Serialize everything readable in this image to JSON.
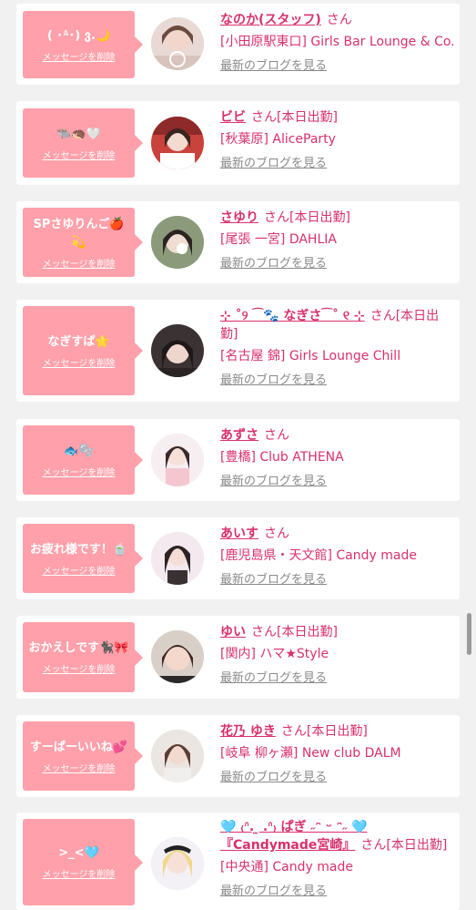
{
  "theme": {
    "accent": "#d8306c",
    "bubble": "#ffa0aa",
    "link_gray": "#8a8a8a"
  },
  "common": {
    "san": "さん",
    "delete_label": "メッセージを削除",
    "blog_label": "最新のブログを見る"
  },
  "items": [
    {
      "message": "( ･ᐞ･) ვ.🌙",
      "name": "なのか(スタッフ)",
      "status": "",
      "shop": "[小田原駅東口] Girls Bar Lounge & Co.",
      "avatar_icon": "avatar-photo"
    },
    {
      "message": "🐃🦔🤍",
      "name": "ビビ",
      "status": "[本日出勤]",
      "shop": "[秋葉原] AliceParty",
      "avatar_icon": "avatar-photo"
    },
    {
      "message": "SPさゆりんご🍎💫",
      "name": "さゆり",
      "status": "[本日出勤]",
      "shop": "[尾張 一宮] DAHLIA",
      "avatar_icon": "avatar-photo"
    },
    {
      "message": "なぎすぱ🌟",
      "name": "⊹ ˚୨ ⁀🐾 なぎさ⁀˚ ୧ ⊹",
      "status": "[本日出勤]",
      "shop": "[名古屋 錦] Girls Lounge Chill",
      "avatar_icon": "avatar-photo"
    },
    {
      "message": "🐟🫧",
      "name": "あずさ",
      "status": "",
      "shop": "[豊橋] Club ATHENA",
      "avatar_icon": "avatar-photo"
    },
    {
      "message": "お疲れ様です！🍵",
      "name": "あいす",
      "status": "",
      "shop": "[鹿児島県・天文館] Candy made",
      "avatar_icon": "avatar-photo"
    },
    {
      "message": "おかえしです🐈‍⬛🎀",
      "name": "ゆい",
      "status": "[本日出勤]",
      "shop": "[関内] ハマ★Style",
      "avatar_icon": "avatar-photo"
    },
    {
      "message": "すーぱーいいね💕",
      "name": "花乃 ゆき",
      "status": "[本日出勤]",
      "shop": "[岐阜 柳ヶ瀬] New club DALM",
      "avatar_icon": "avatar-photo"
    },
    {
      "message": ">_<🩵",
      "name": "🩵 ₍ᐢ. ̫ .ᐢ₎ ぱぎ ˶ᵔ ᵕ ᵔ˶ 🩵『Candymade宮崎』",
      "status": "[本日出勤]",
      "shop": "[中央通] Candy made",
      "avatar_icon": "avatar-photo"
    }
  ]
}
